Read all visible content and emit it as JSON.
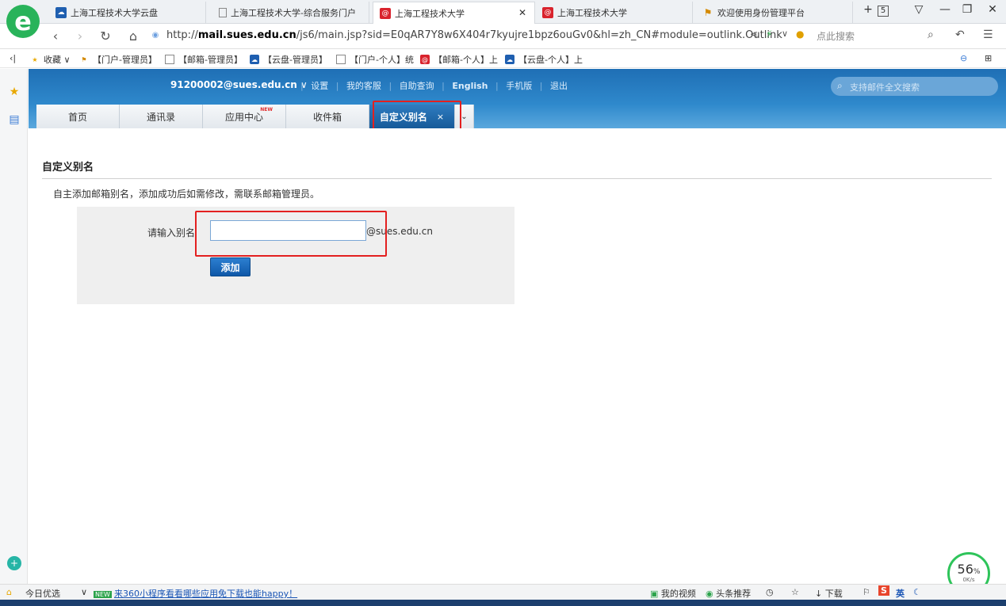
{
  "browser": {
    "tabs": [
      {
        "title": "上海工程技术大学云盘",
        "icon": "cloud-icon"
      },
      {
        "title": "上海工程技术大学-综合服务门户",
        "icon": "page-icon"
      },
      {
        "title": "上海工程技术大学",
        "icon": "mail-icon",
        "active": true
      },
      {
        "title": "上海工程技术大学",
        "icon": "mail-icon"
      },
      {
        "title": "欢迎使用身份管理平台",
        "icon": "id-icon"
      }
    ],
    "tab_count": "5",
    "url_prefix": "http://",
    "url_domain": "mail.sues.edu.cn",
    "url_rest": "/js6/main.jsp?sid=E0qAR7Y8w6X404r7kyujre1bpz6ouGv0&hl=zh_CN#module=outlink.Outlink",
    "search_placeholder": "点此搜索",
    "bookmarks": [
      {
        "label": "收藏",
        "icon": "star-icon"
      },
      {
        "label": "【门户-管理员】",
        "icon": "id-icon"
      },
      {
        "label": "【邮箱-管理员】",
        "icon": "page-icon"
      },
      {
        "label": "【云盘-管理员】",
        "icon": "cloud-icon"
      },
      {
        "label": "【门户-个人】统",
        "icon": "page-icon"
      },
      {
        "label": "【邮箱-个人】上",
        "icon": "mail-icon"
      },
      {
        "label": "【云盘-个人】上",
        "icon": "cloud-icon"
      }
    ]
  },
  "mail": {
    "account": "91200002@sues.edu.cn",
    "account_caret": "∨",
    "toplinks": [
      "设置",
      "我的客服",
      "自助查询",
      "English",
      "手机版",
      "退出"
    ],
    "search_placeholder": "支持邮件全文搜索",
    "nav": [
      {
        "label": "首页"
      },
      {
        "label": "通讯录"
      },
      {
        "label": "应用中心",
        "badge": "NEW"
      },
      {
        "label": "收件箱"
      }
    ],
    "active_tab": {
      "label": "自定义别名",
      "close": "×"
    },
    "more_tab": "⌄"
  },
  "page": {
    "title": "自定义别名",
    "description": "自主添加邮箱别名，添加成功后如需修改，需联系邮箱管理员。",
    "form": {
      "label": "请输入别名",
      "value": "",
      "suffix": "@sues.edu.cn",
      "button": "添加"
    }
  },
  "widget": {
    "percent": "56",
    "percent_unit": "%",
    "rate": "0K/s"
  },
  "bottom": {
    "today": "今日优选",
    "news_badge": "NEW",
    "news": "来360小程序看看哪些应用免下载也能happy！",
    "video": "我的视频",
    "headlines": "头条推荐",
    "download": "下载",
    "ime": "英"
  },
  "colors": {
    "accent": "#1f6fb5",
    "highlight": "#e32020",
    "brand_green": "#29b35a"
  }
}
